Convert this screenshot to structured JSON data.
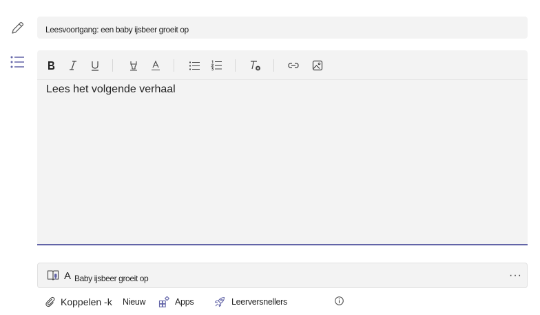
{
  "title_field": {
    "value": "Leesvoortgang: een baby ijsbeer groeit op"
  },
  "editor": {
    "content": "Lees het volgende verhaal",
    "accent_color": "#6264a7",
    "toolbar": [
      {
        "icon": "bold-icon"
      },
      {
        "icon": "italic-icon"
      },
      {
        "icon": "underline-icon"
      },
      {
        "icon": "highlight-icon"
      },
      {
        "icon": "font-color-icon"
      },
      {
        "icon": "bullet-list-icon"
      },
      {
        "icon": "numbered-list-icon"
      },
      {
        "icon": "clear-formatting-icon"
      },
      {
        "icon": "link-icon"
      },
      {
        "icon": "image-icon"
      }
    ]
  },
  "resource": {
    "prefix": "A",
    "name": "Baby ijsbeer groeit op",
    "more": "···",
    "icon": "reading-progress-icon"
  },
  "bottom_bar": {
    "attach_label": "Koppelen -k",
    "new_label": "Nieuw",
    "apps_label": "Apps",
    "accelerators_label": "Leerversnellers",
    "info_icon": "info-icon"
  }
}
